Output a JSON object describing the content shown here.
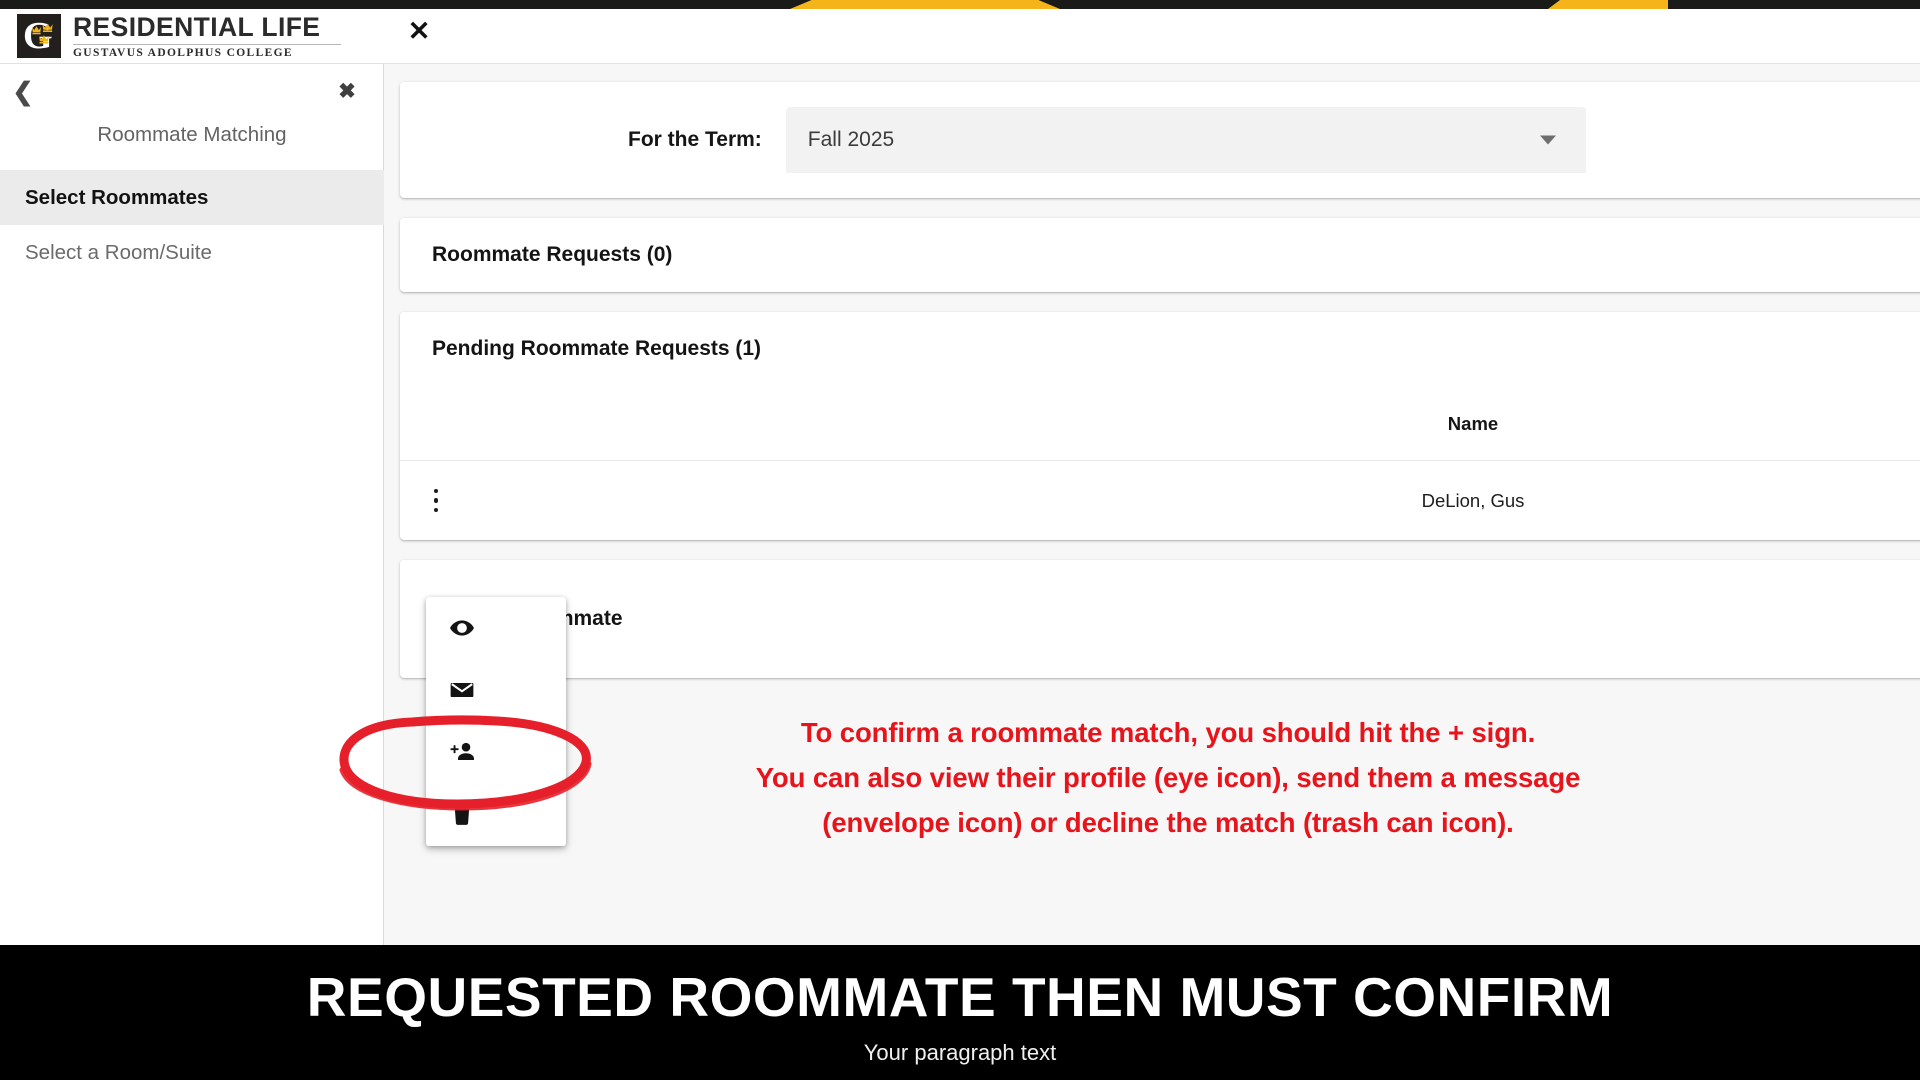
{
  "brand": {
    "title": "RESIDENTIAL LIFE",
    "subtitle": "GUSTAVUS ADOLPHUS COLLEGE",
    "logo_letter": "G",
    "logo_icon": "gustavus-crown-g-logo"
  },
  "sidebar": {
    "back_icon": "chevron-left-icon",
    "close_icon": "close-x-icon",
    "section_title": "Roommate Matching",
    "items": [
      {
        "label": "Select Roommates",
        "active": true
      },
      {
        "label": "Select a Room/Suite",
        "active": false
      }
    ]
  },
  "main": {
    "close_icon": "close-x-icon",
    "term": {
      "label": "For the Term:",
      "value": "Fall 2025",
      "caret_icon": "chevron-down-icon"
    },
    "sections": {
      "roommate_requests_title": "Roommate Requests (0)",
      "pending_title": "Pending Roommate Requests (1)",
      "request_card_title": "ommate"
    },
    "table": {
      "columns": [
        "",
        "Name"
      ],
      "row_menu_icon": "kebab-vertical-icon",
      "rows": [
        {
          "name": "DeLion, Gus"
        }
      ]
    },
    "action_menu": {
      "items": [
        {
          "icon": "eye-icon",
          "label": "View Profile"
        },
        {
          "icon": "envelope-icon",
          "label": "Send Message"
        },
        {
          "icon": "person-add-icon",
          "label": "Confirm Match"
        },
        {
          "icon": "trash-icon",
          "label": "Decline Match"
        }
      ]
    }
  },
  "annotation": {
    "color": "#e8141b",
    "highlight_shape": "red-ellipse-around-person-add-icon",
    "lines": [
      "To confirm a roommate match, you should hit the + sign.",
      "You can also view their profile (eye icon), send them a message",
      "(envelope icon) or decline the match (trash can icon)."
    ]
  },
  "banner": {
    "title": "REQUESTED ROOMMATE THEN MUST CONFIRM",
    "subtitle": "Your paragraph text",
    "background": "#000000"
  }
}
